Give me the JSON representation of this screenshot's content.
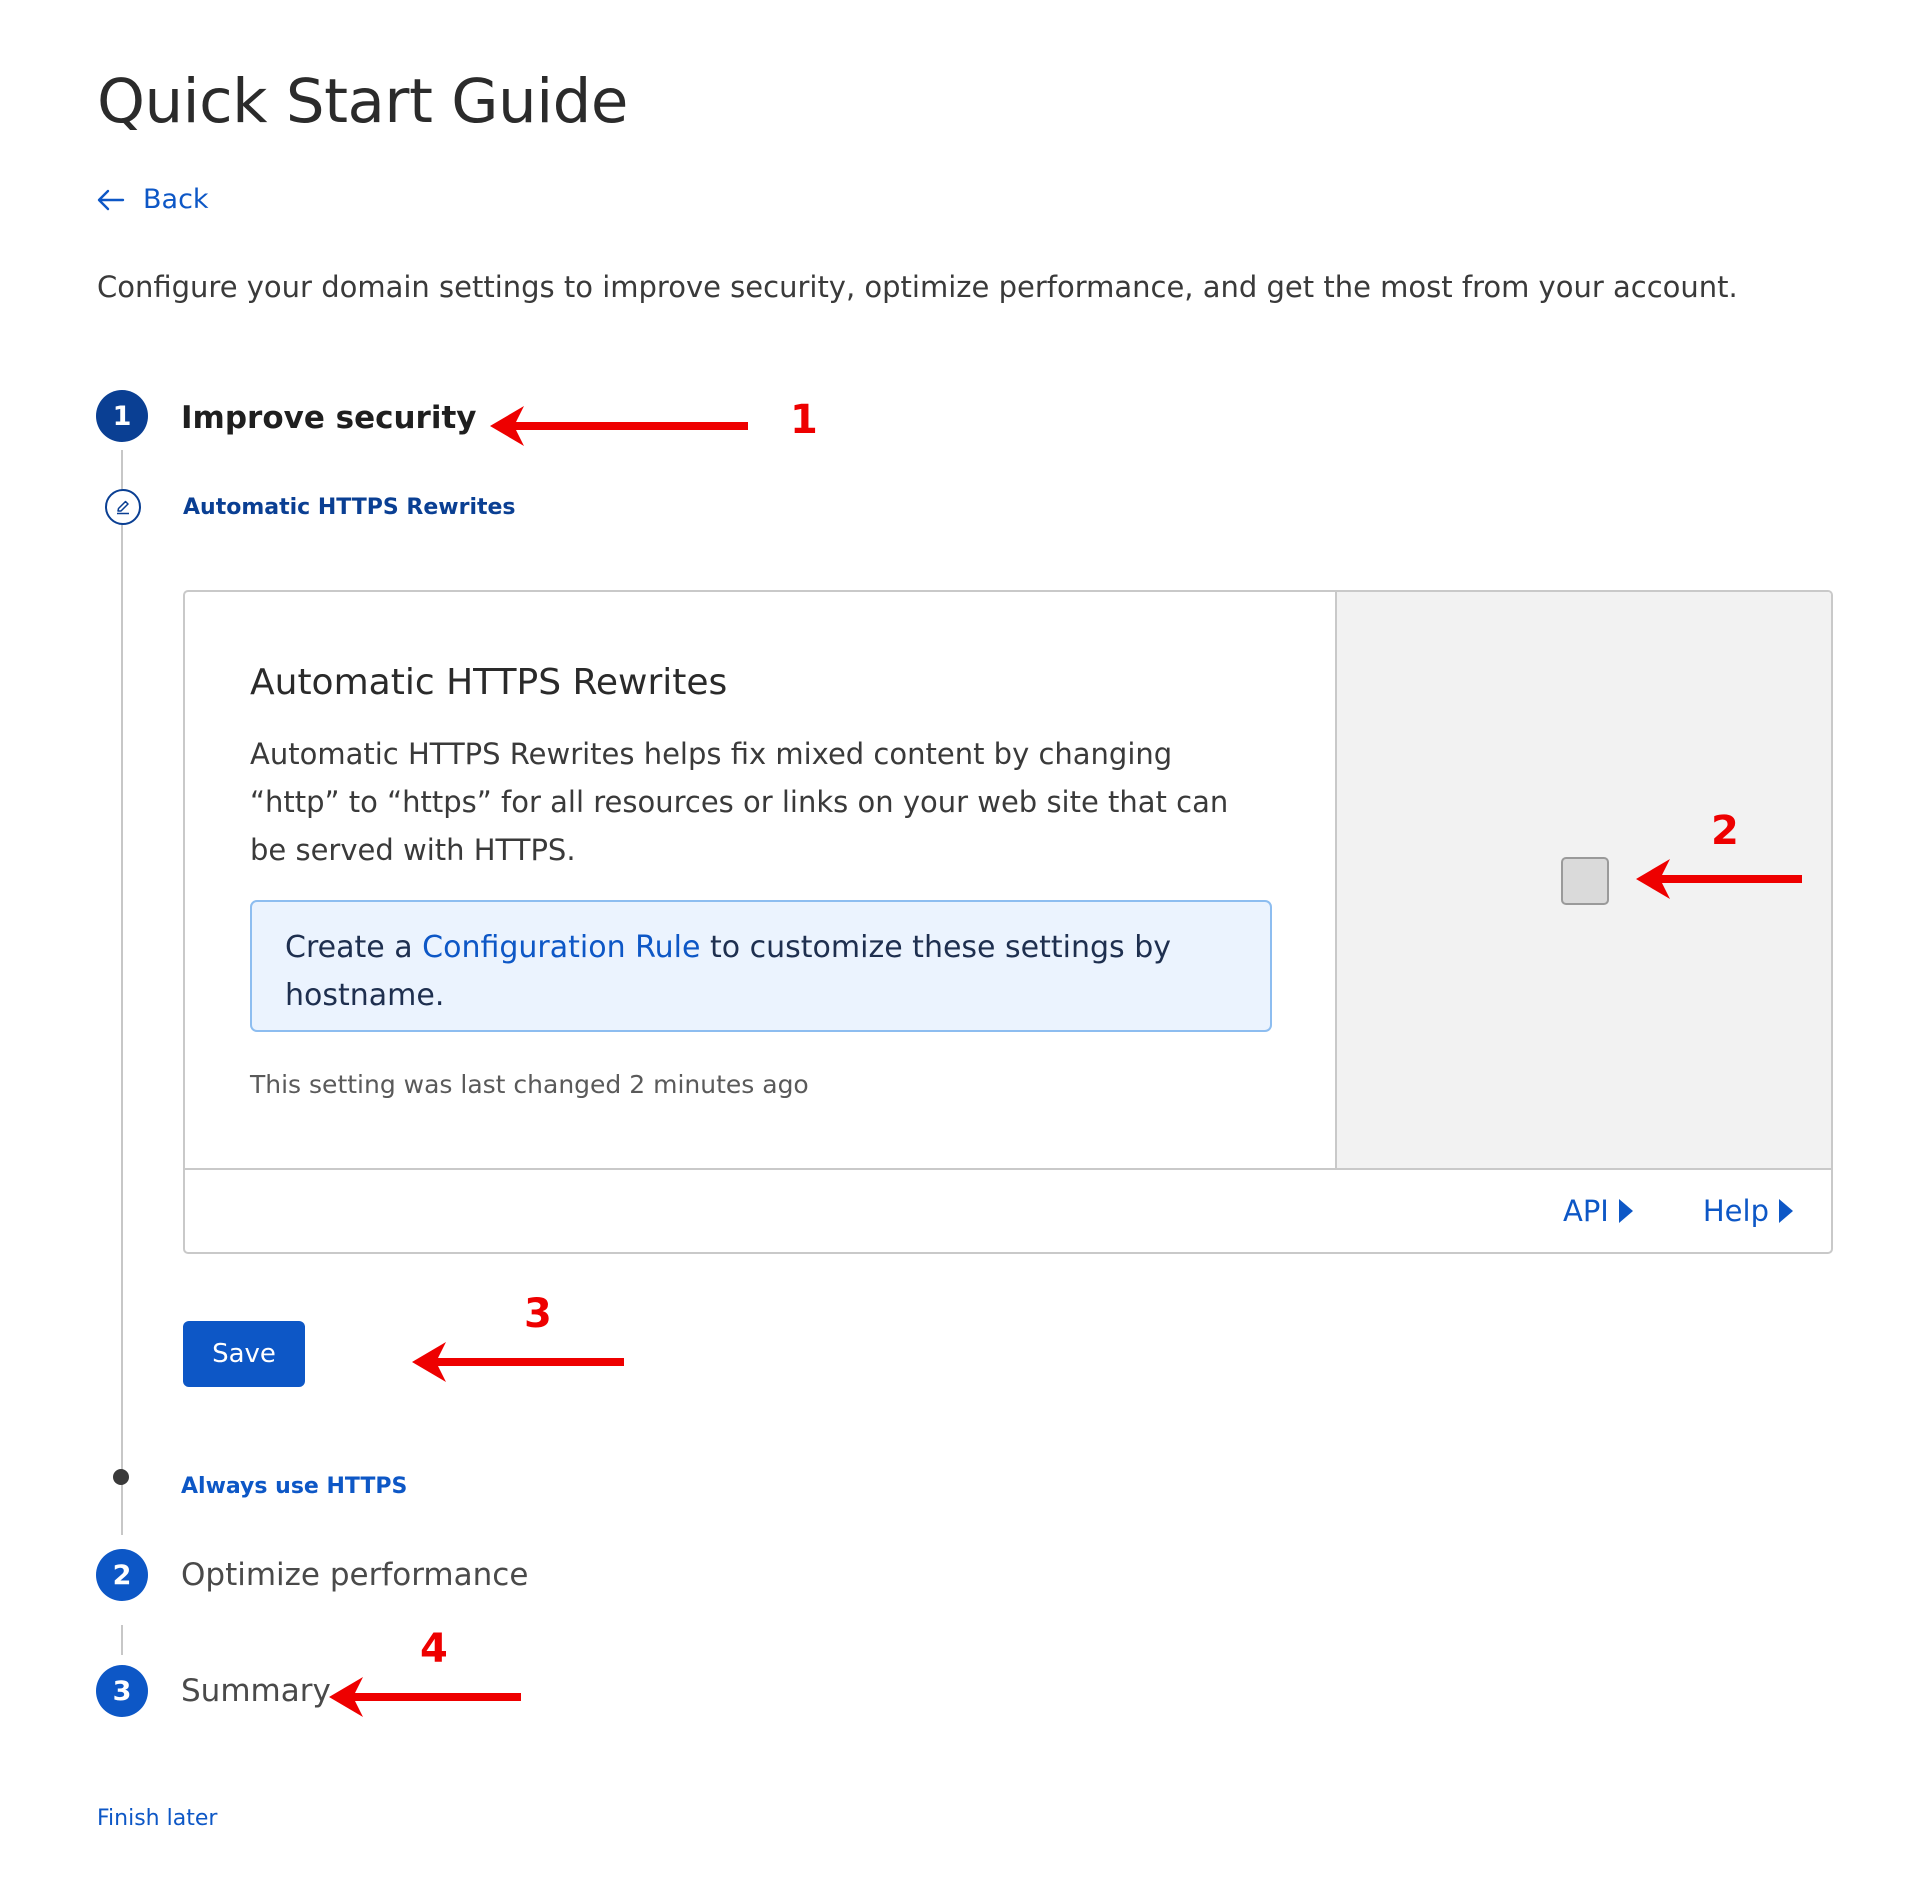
{
  "page": {
    "title": "Quick Start Guide",
    "back_label": "Back",
    "intro": "Configure your domain settings to improve security, optimize performance, and get the most from your account.",
    "finish_later": "Finish later"
  },
  "steps": [
    {
      "number": "1",
      "label": "Improve security",
      "state": "active"
    },
    {
      "number": "2",
      "label": "Optimize performance",
      "state": "pending"
    },
    {
      "number": "3",
      "label": "Summary",
      "state": "pending"
    }
  ],
  "substeps": {
    "current": "Automatic HTTPS Rewrites",
    "next": "Always use HTTPS"
  },
  "card": {
    "title": "Automatic HTTPS Rewrites",
    "description": "Automatic HTTPS Rewrites helps fix mixed content by changing “http” to “https” for all resources or links on your web site that can be served with HTTPS.",
    "info_prefix": "Create a ",
    "info_link": "Configuration Rule",
    "info_suffix": " to customize these settings by hostname.",
    "last_changed": "This setting was last changed 2 minutes ago",
    "toggle_checked": false,
    "footer": {
      "api": "API",
      "help": "Help"
    }
  },
  "save_label": "Save",
  "annotations": [
    "1",
    "2",
    "3",
    "4"
  ],
  "colors": {
    "primary": "#0d57c6",
    "primary_dark": "#0a3f93",
    "annotation": "#ee0000",
    "info_bg": "#ebf3fe",
    "side_panel_bg": "#f2f2f2"
  }
}
